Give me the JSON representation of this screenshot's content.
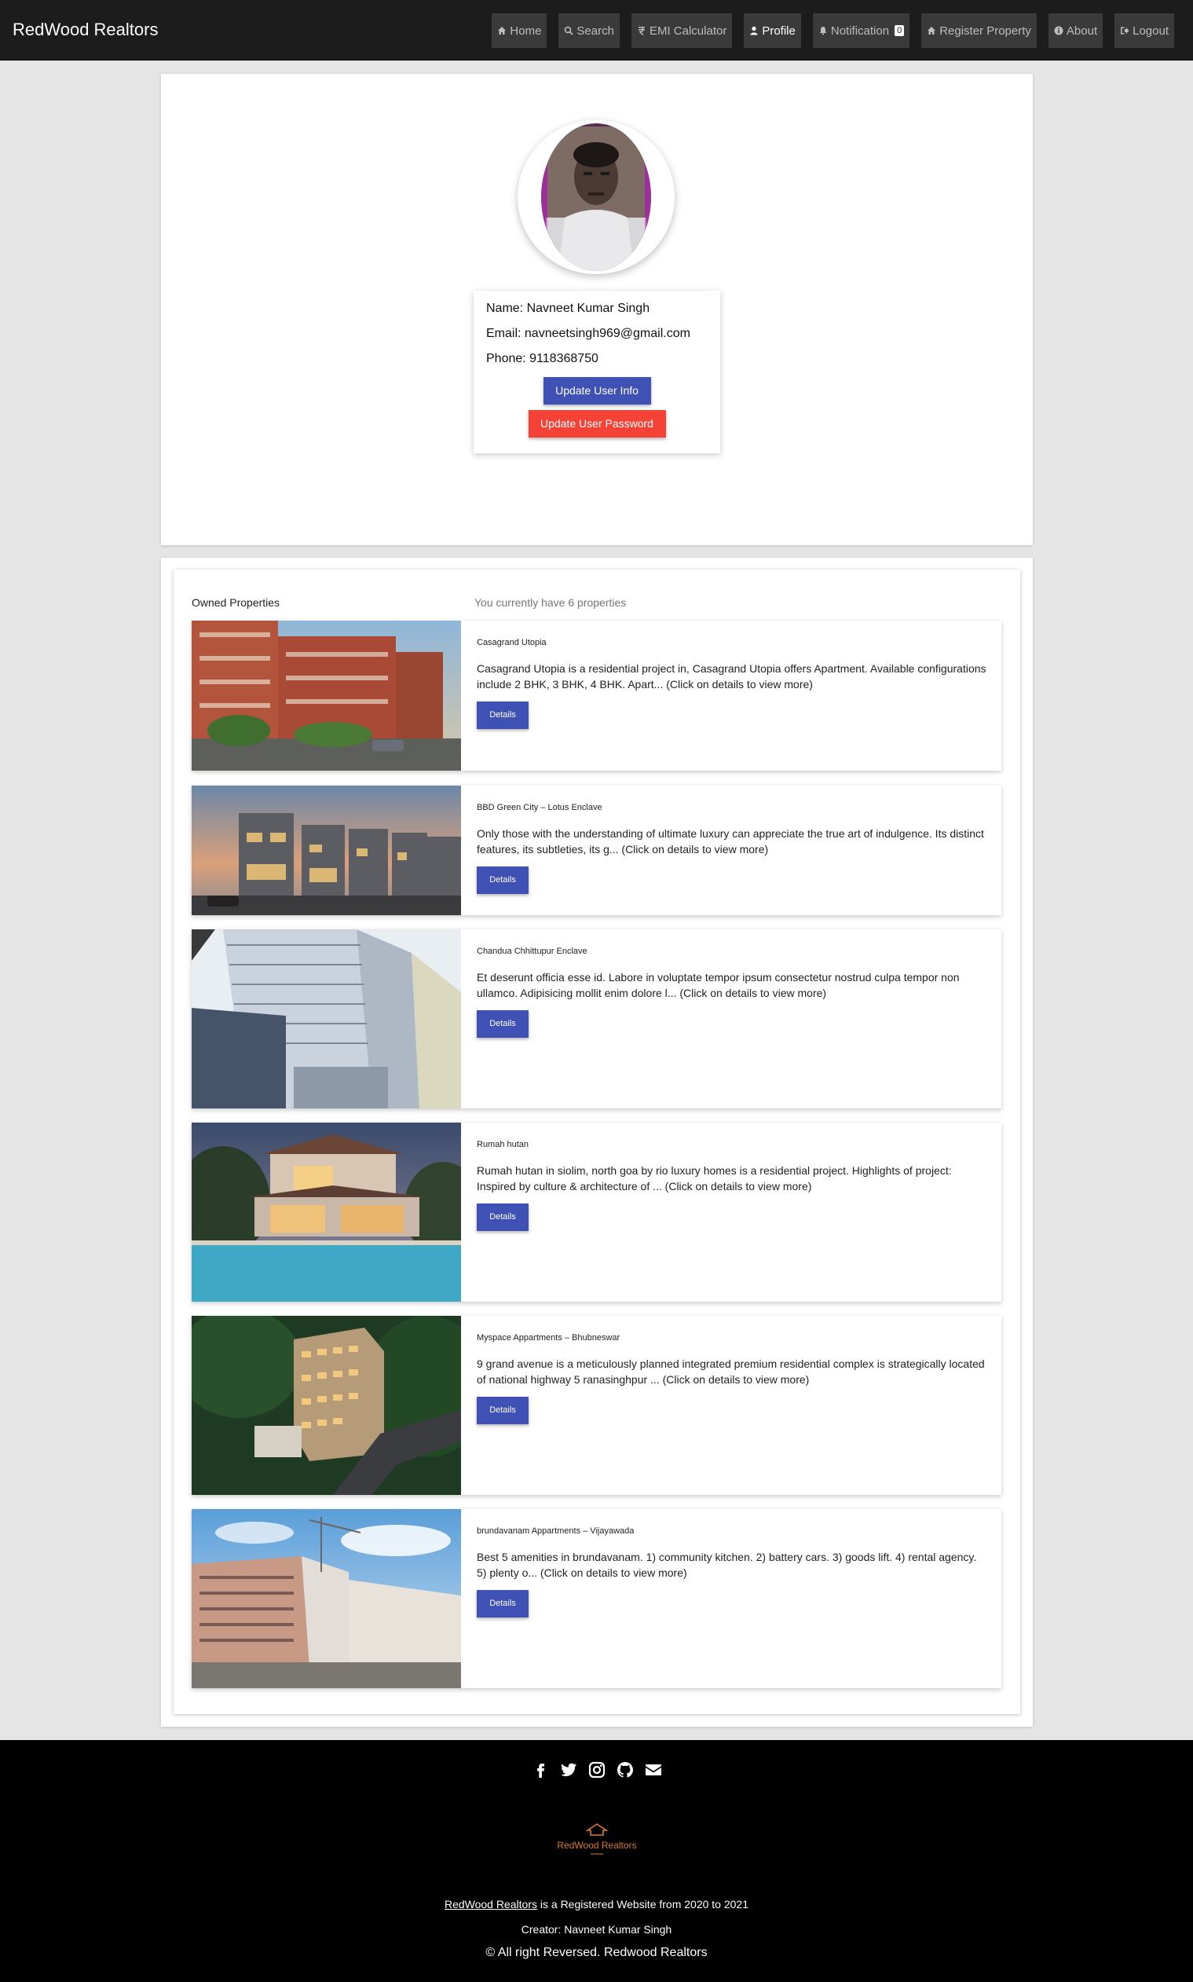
{
  "navbar": {
    "brand": "RedWood Realtors",
    "items": [
      {
        "label": "Home",
        "icon": "home-icon"
      },
      {
        "label": "Search",
        "icon": "search-icon"
      },
      {
        "label": "EMI Calculator",
        "icon": "rupee-icon"
      },
      {
        "label": "Profile",
        "icon": "user-icon",
        "active": true
      },
      {
        "label": "Notification",
        "icon": "bell-icon",
        "badge": "0"
      },
      {
        "label": "Register Property",
        "icon": "home-icon"
      },
      {
        "label": "About",
        "icon": "info-icon"
      },
      {
        "label": "Logout",
        "icon": "logout-icon"
      }
    ]
  },
  "profile": {
    "name_line": "Name: Navneet Kumar Singh",
    "email_line": "Email: navneetsingh969@gmail.com",
    "phone_line": "Phone: 9118368750",
    "update_info_label": "Update User Info",
    "update_password_label": "Update User Password"
  },
  "properties": {
    "title": "Owned Properties",
    "count_text": "You currently have 6 properties",
    "details_label": "Details",
    "items": [
      {
        "name": "Casagrand Utopia",
        "description": "Casagrand Utopia is a residential project in, Casagrand Utopia offers Apartment. Available configurations include 2 BHK, 3 BHK, 4 BHK. Apart... (Click on details to view more)"
      },
      {
        "name": "BBD Green City – Lotus Enclave",
        "description": "Only those with the understanding of ultimate luxury can appreciate the true art of indulgence. Its distinct features, its subtleties, its g... (Click on details to view more)"
      },
      {
        "name": "Chandua Chhittupur Enclave",
        "description": "Et deserunt officia esse id. Labore in voluptate tempor ipsum consectetur nostrud culpa tempor non ullamco. Adipisicing mollit enim dolore l... (Click on details to view more)"
      },
      {
        "name": "Rumah hutan",
        "description": "Rumah hutan in siolim, north goa by rio luxury homes is a residential project. Highlights of project: Inspired by culture & architecture of ... (Click on details to view more)"
      },
      {
        "name": "Myspace Appartments – Bhubneswar",
        "description": "9 grand avenue is a meticulously planned integrated premium residential complex is strategically located of national highway 5 ranasinghpur ... (Click on details to view more)"
      },
      {
        "name": "brundavanam Appartments – Vijayawada",
        "description": "Best 5 amenities in brundavanam. 1) community kitchen. 2) battery cars. 3) goods lift. 4) rental agency. 5) plenty o... (Click on details to view more)"
      }
    ]
  },
  "footer": {
    "logo_text": "RedWood Realtors",
    "registered_link": "RedWood Realtors",
    "registered_text": " is a Registered Website from 2020 to 2021",
    "creator": "Creator: Navneet Kumar Singh",
    "copyright": "© All right Reversed.  Redwood Realtors",
    "social": [
      "facebook-icon",
      "twitter-icon",
      "instagram-icon",
      "github-icon",
      "envelope-icon"
    ]
  }
}
